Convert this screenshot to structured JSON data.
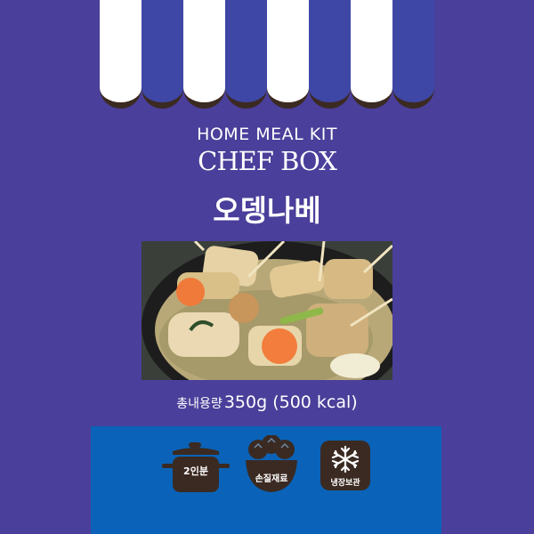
{
  "header": {
    "kicker": "HOME MEAL KIT",
    "brand": "CHEF BOX",
    "product_name": "오뎅나베"
  },
  "photo": {
    "subject": "fish-cake-hot-pot-photo"
  },
  "spec": {
    "weight_label": "총내용량",
    "weight_value": "350g (500 kcal)"
  },
  "features": [
    {
      "icon": "pot-icon",
      "label": "2인분"
    },
    {
      "icon": "vegetable-bowl-icon",
      "label": "손질재료"
    },
    {
      "icon": "snowflake-icon",
      "label": "냉장보관"
    }
  ],
  "colors": {
    "background": "#4a3f9a",
    "awning_blue": "#3e47a6",
    "awning_white": "#ffffff",
    "awning_trim": "#3b2a22",
    "panel": "#0a63b8",
    "icon_dark": "#3b2a22"
  }
}
